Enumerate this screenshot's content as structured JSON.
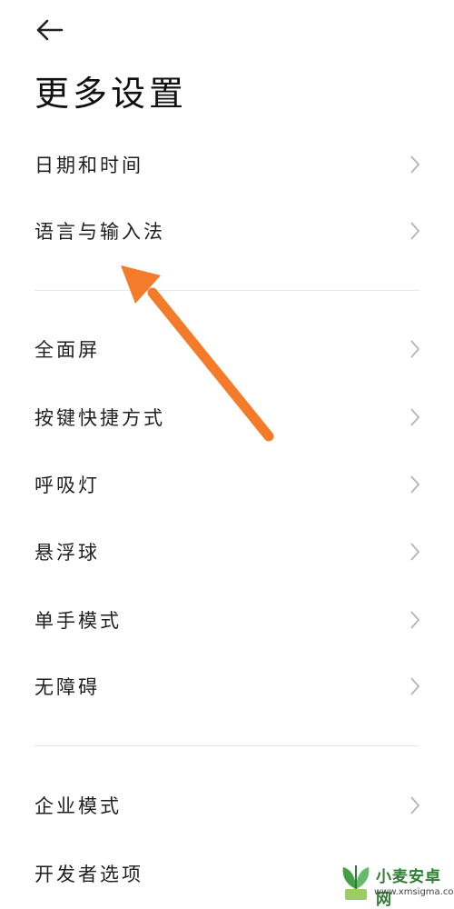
{
  "header": {
    "back_icon": "back-arrow-icon",
    "title": "更多设置"
  },
  "groups": [
    {
      "items": [
        {
          "label": "日期和时间"
        },
        {
          "label": "语言与输入法"
        }
      ]
    },
    {
      "items": [
        {
          "label": "全面屏"
        },
        {
          "label": "按键快捷方式"
        },
        {
          "label": "呼吸灯"
        },
        {
          "label": "悬浮球"
        },
        {
          "label": "单手模式"
        },
        {
          "label": "无障碍"
        }
      ]
    },
    {
      "items": [
        {
          "label": "企业模式"
        },
        {
          "label": "开发者选项"
        }
      ]
    }
  ],
  "annotation": {
    "color": "#F47B2A"
  },
  "watermark": {
    "title": "小麦安卓网",
    "url": "www.xmsigma.com"
  }
}
